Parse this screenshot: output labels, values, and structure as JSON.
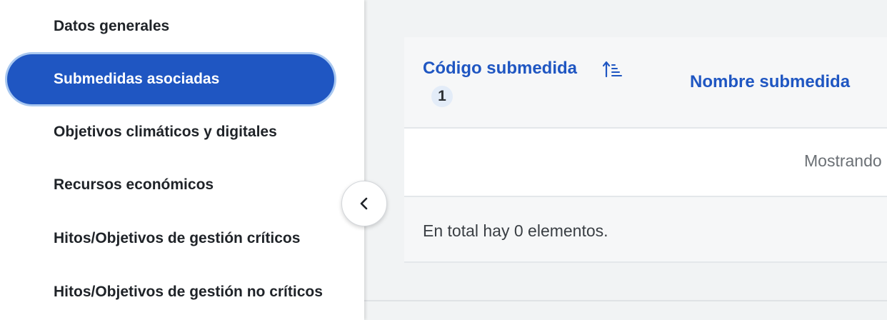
{
  "sidebar": {
    "items": [
      {
        "label": "Datos generales",
        "active": false
      },
      {
        "label": "Submedidas asociadas",
        "active": true
      },
      {
        "label": "Objetivos climáticos y digitales",
        "active": false
      },
      {
        "label": "Recursos económicos",
        "active": false
      },
      {
        "label": "Hitos/Objetivos de gestión críticos",
        "active": false
      },
      {
        "label": "Hitos/Objetivos de gestión no críticos",
        "active": false
      }
    ],
    "collapse_icon": "chevron-left-icon"
  },
  "table": {
    "columns": {
      "code": {
        "label": "Código submedida",
        "sort_icon": "sort-ascending-icon",
        "sort_order": "1"
      },
      "name": {
        "label": "Nombre submedida"
      }
    },
    "showing_text": "Mostrando",
    "total_text": "En total hay 0 elementos."
  },
  "colors": {
    "accent": "#1f56c2",
    "active_ring": "#a9c8f0",
    "text_dark": "#1f2328"
  }
}
